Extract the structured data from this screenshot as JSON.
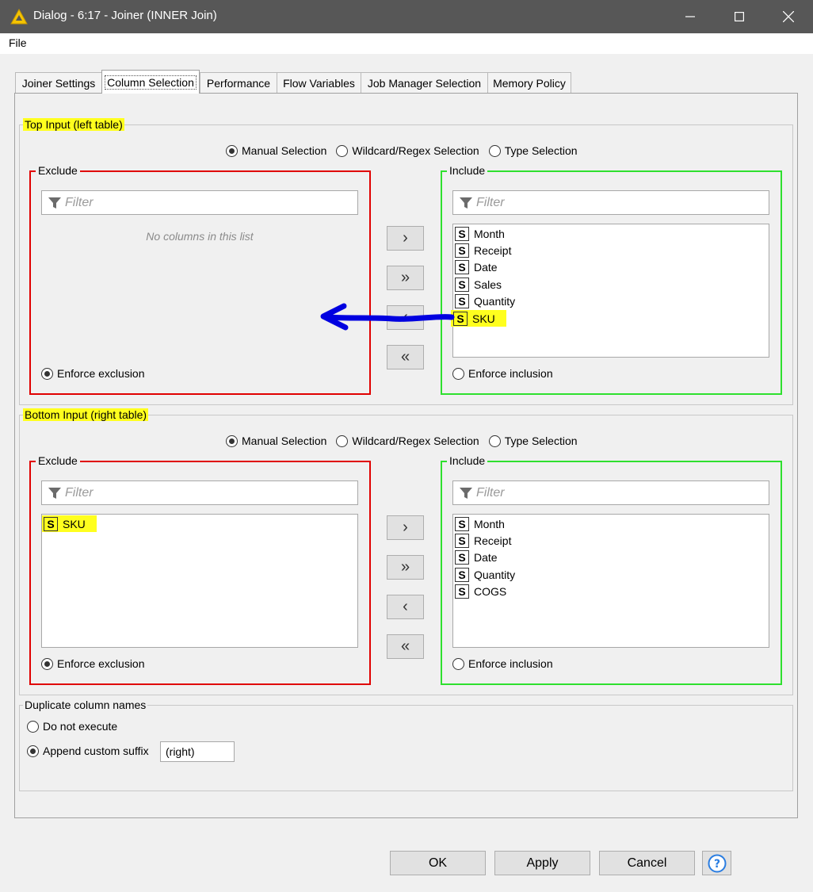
{
  "window": {
    "title": "Dialog - 6:17 - Joiner (INNER Join)"
  },
  "menu": {
    "file": "File"
  },
  "tabs": [
    {
      "label": "Joiner Settings"
    },
    {
      "label": "Column Selection"
    },
    {
      "label": "Performance"
    },
    {
      "label": "Flow Variables"
    },
    {
      "label": "Job Manager Selection"
    },
    {
      "label": "Memory Policy"
    }
  ],
  "active_tab": "Column Selection",
  "selection_modes": {
    "manual": "Manual Selection",
    "wildcard": "Wildcard/Regex Selection",
    "type": "Type Selection"
  },
  "top_input": {
    "title": "Top Input (left table)",
    "selected_mode": "Manual Selection",
    "exclude": {
      "title": "Exclude",
      "filter_placeholder": "Filter",
      "empty_text": "No columns in this list",
      "items": [],
      "enforce_label": "Enforce exclusion",
      "enforce_selected": true
    },
    "include": {
      "title": "Include",
      "filter_placeholder": "Filter",
      "items": [
        {
          "type": "S",
          "name": "Month"
        },
        {
          "type": "S",
          "name": "Receipt"
        },
        {
          "type": "S",
          "name": "Date"
        },
        {
          "type": "S",
          "name": "Sales"
        },
        {
          "type": "S",
          "name": "Quantity"
        },
        {
          "type": "S",
          "name": "SKU",
          "highlighted": true
        }
      ],
      "enforce_label": "Enforce inclusion",
      "enforce_selected": false
    }
  },
  "bottom_input": {
    "title": "Bottom Input (right table)",
    "selected_mode": "Manual Selection",
    "exclude": {
      "title": "Exclude",
      "filter_placeholder": "Filter",
      "items": [
        {
          "type": "S",
          "name": "SKU",
          "highlighted": true
        }
      ],
      "enforce_label": "Enforce exclusion",
      "enforce_selected": true
    },
    "include": {
      "title": "Include",
      "filter_placeholder": "Filter",
      "items": [
        {
          "type": "S",
          "name": "Month"
        },
        {
          "type": "S",
          "name": "Receipt"
        },
        {
          "type": "S",
          "name": "Date"
        },
        {
          "type": "S",
          "name": "Quantity"
        },
        {
          "type": "S",
          "name": "COGS"
        }
      ],
      "enforce_label": "Enforce inclusion",
      "enforce_selected": false
    }
  },
  "arrow_buttons": {
    "add": "›",
    "add_all": "»",
    "remove": "‹",
    "remove_all": "«"
  },
  "duplicates": {
    "title": "Duplicate column names",
    "do_not_execute": "Do not execute",
    "append_suffix": "Append custom suffix",
    "selected": "append_suffix",
    "suffix_value": "(right)"
  },
  "buttons": {
    "ok": "OK",
    "apply": "Apply",
    "cancel": "Cancel"
  },
  "colors": {
    "highlight": "#ffff1e",
    "exclude_border": "#e00000",
    "include_border": "#2ee02e",
    "annotation_arrow": "#0000e0",
    "app_icon": "#f5c400"
  }
}
